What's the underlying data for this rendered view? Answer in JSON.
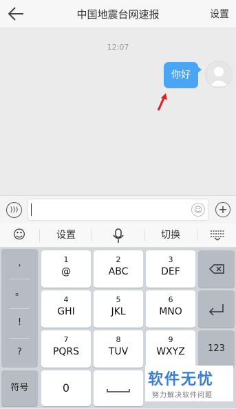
{
  "header": {
    "title": "中国地震台网速报",
    "settings_label": "设置",
    "back_icon": "back-arrow-icon"
  },
  "chat": {
    "time": "12:07",
    "message": "你好",
    "bubble_color": "#4aa6f5",
    "annotation_color": "#e02020"
  },
  "input": {
    "value": ""
  },
  "kb_toolbar": {
    "settings_label": "设置",
    "switch_label": "切换"
  },
  "keyboard": {
    "punctuation": [
      ",",
      "。",
      "!",
      "?"
    ],
    "rows": [
      [
        {
          "num": "1",
          "let": "@"
        },
        {
          "num": "2",
          "let": "ABC"
        },
        {
          "num": "3",
          "let": "DEF"
        }
      ],
      [
        {
          "num": "4",
          "let": "GHI"
        },
        {
          "num": "5",
          "let": "JKL"
        },
        {
          "num": "6",
          "let": "MNO"
        }
      ],
      [
        {
          "num": "7",
          "let": "PQRS"
        },
        {
          "num": "8",
          "let": "TUV"
        },
        {
          "num": "9",
          "let": "WXYZ"
        }
      ]
    ],
    "symbol_label": "符号",
    "zero_label": "0",
    "right_123": "123"
  },
  "watermark": {
    "main": "软件无忧",
    "sub": "努力解决软件问题"
  }
}
